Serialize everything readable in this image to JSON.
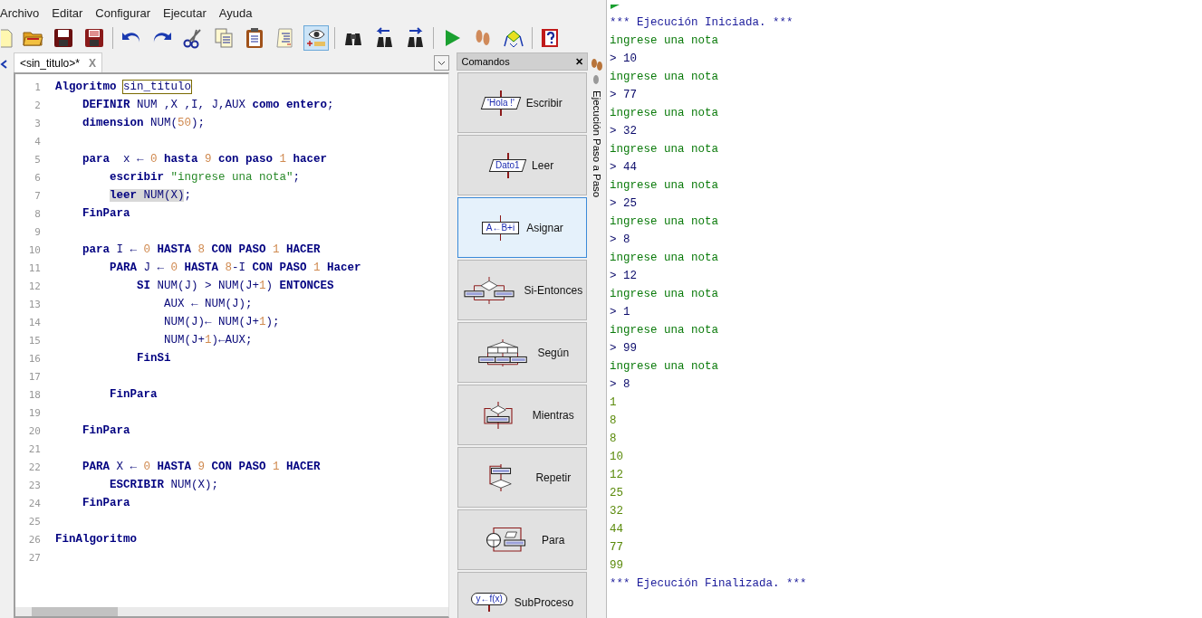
{
  "menu": [
    "Archivo",
    "Editar",
    "Configurar",
    "Ejecutar",
    "Ayuda"
  ],
  "toolbar": [
    {
      "kind": "new",
      "selected": false
    },
    {
      "kind": "open",
      "selected": false
    },
    {
      "kind": "save",
      "selected": false
    },
    {
      "kind": "saveas",
      "selected": false
    },
    {
      "kind": "sep"
    },
    {
      "kind": "undo",
      "selected": false
    },
    {
      "kind": "redo",
      "selected": false
    },
    {
      "kind": "cut",
      "selected": false
    },
    {
      "kind": "copy",
      "selected": false
    },
    {
      "kind": "paste",
      "selected": false
    },
    {
      "kind": "indent",
      "selected": false
    },
    {
      "kind": "watch",
      "selected": true
    },
    {
      "kind": "sep"
    },
    {
      "kind": "find",
      "selected": false
    },
    {
      "kind": "findprev",
      "selected": false
    },
    {
      "kind": "findnext",
      "selected": false
    },
    {
      "kind": "sep"
    },
    {
      "kind": "run",
      "selected": false
    },
    {
      "kind": "steps",
      "selected": false
    },
    {
      "kind": "flow",
      "selected": false
    },
    {
      "kind": "sep"
    },
    {
      "kind": "help",
      "selected": false
    }
  ],
  "editor_tab": {
    "label": "<sin_titulo>*",
    "close": "X"
  },
  "code_lines": [
    {
      "number": "1",
      "tokens": [
        {
          "kind": "keyword",
          "text": "Algoritmo "
        },
        {
          "kind": "boxed",
          "text": "sin_titulo"
        }
      ]
    },
    {
      "number": "2",
      "tokens": [
        {
          "kind": "keyword",
          "text": "    DEFINIR"
        },
        {
          "kind": "plain",
          "text": " NUM ,X ,I, J,AUX "
        },
        {
          "kind": "keyword",
          "text": "como entero"
        },
        {
          "kind": "plain",
          "text": ";"
        }
      ]
    },
    {
      "number": "3",
      "tokens": [
        {
          "kind": "keyword",
          "text": "    dimension"
        },
        {
          "kind": "plain",
          "text": " NUM("
        },
        {
          "kind": "number",
          "text": "50"
        },
        {
          "kind": "plain",
          "text": ");"
        }
      ]
    },
    {
      "number": "4"
    },
    {
      "number": "5",
      "tokens": [
        {
          "kind": "keyword",
          "text": "    para"
        },
        {
          "kind": "plain",
          "text": "  x ← "
        },
        {
          "kind": "number",
          "text": "0"
        },
        {
          "kind": "keyword",
          "text": " hasta "
        },
        {
          "kind": "number",
          "text": "9"
        },
        {
          "kind": "keyword",
          "text": " con paso "
        },
        {
          "kind": "number",
          "text": "1"
        },
        {
          "kind": "keyword",
          "text": " hacer"
        }
      ]
    },
    {
      "number": "6",
      "tokens": [
        {
          "kind": "keyword",
          "text": "        escribir "
        },
        {
          "kind": "string",
          "text": "\"ingrese una nota\""
        },
        {
          "kind": "plain",
          "text": ";"
        }
      ]
    },
    {
      "number": "7",
      "tokens": [
        {
          "kind": "selected-keyword",
          "text": "        leer"
        },
        {
          "kind": "selected-plain",
          "text": " NUM(X)"
        },
        {
          "kind": "plain",
          "text": ";"
        }
      ]
    },
    {
      "number": "8",
      "tokens": [
        {
          "kind": "keyword",
          "text": "    FinPara"
        }
      ]
    },
    {
      "number": "9"
    },
    {
      "number": "10",
      "tokens": [
        {
          "kind": "keyword",
          "text": "    para"
        },
        {
          "kind": "plain",
          "text": " I ← "
        },
        {
          "kind": "number",
          "text": "0"
        },
        {
          "kind": "keyword",
          "text": " HASTA "
        },
        {
          "kind": "number",
          "text": "8"
        },
        {
          "kind": "keyword",
          "text": " CON PASO "
        },
        {
          "kind": "number",
          "text": "1"
        },
        {
          "kind": "keyword",
          "text": " HACER"
        }
      ]
    },
    {
      "number": "11",
      "tokens": [
        {
          "kind": "keyword",
          "text": "        PARA"
        },
        {
          "kind": "plain",
          "text": " J ← "
        },
        {
          "kind": "number",
          "text": "0"
        },
        {
          "kind": "keyword",
          "text": " HASTA "
        },
        {
          "kind": "number",
          "text": "8"
        },
        {
          "kind": "plain",
          "text": "-I "
        },
        {
          "kind": "keyword",
          "text": "CON PASO "
        },
        {
          "kind": "number",
          "text": "1"
        },
        {
          "kind": "keyword",
          "text": " Hacer"
        }
      ]
    },
    {
      "number": "12",
      "tokens": [
        {
          "kind": "keyword",
          "text": "            SI"
        },
        {
          "kind": "plain",
          "text": " NUM(J) > NUM(J+"
        },
        {
          "kind": "number",
          "text": "1"
        },
        {
          "kind": "plain",
          "text": ") "
        },
        {
          "kind": "keyword",
          "text": "ENTONCES"
        }
      ]
    },
    {
      "number": "13",
      "tokens": [
        {
          "kind": "plain",
          "text": "                AUX ← NUM(J);"
        }
      ]
    },
    {
      "number": "14",
      "tokens": [
        {
          "kind": "plain",
          "text": "                NUM(J)← NUM(J+"
        },
        {
          "kind": "number",
          "text": "1"
        },
        {
          "kind": "plain",
          "text": ");"
        }
      ]
    },
    {
      "number": "15",
      "tokens": [
        {
          "kind": "plain",
          "text": "                NUM(J+"
        },
        {
          "kind": "number",
          "text": "1"
        },
        {
          "kind": "plain",
          "text": ")←AUX;"
        }
      ]
    },
    {
      "number": "16",
      "tokens": [
        {
          "kind": "keyword",
          "text": "            FinSi"
        }
      ]
    },
    {
      "number": "17"
    },
    {
      "number": "18",
      "tokens": [
        {
          "kind": "keyword",
          "text": "        FinPara"
        }
      ]
    },
    {
      "number": "19"
    },
    {
      "number": "20",
      "tokens": [
        {
          "kind": "keyword",
          "text": "    FinPara"
        }
      ]
    },
    {
      "number": "21"
    },
    {
      "number": "22",
      "tokens": [
        {
          "kind": "keyword",
          "text": "    PARA"
        },
        {
          "kind": "plain",
          "text": " X ← "
        },
        {
          "kind": "number",
          "text": "0"
        },
        {
          "kind": "keyword",
          "text": " HASTA "
        },
        {
          "kind": "number",
          "text": "9"
        },
        {
          "kind": "keyword",
          "text": " CON PASO "
        },
        {
          "kind": "number",
          "text": "1"
        },
        {
          "kind": "keyword",
          "text": " HACER"
        }
      ]
    },
    {
      "number": "23",
      "tokens": [
        {
          "kind": "keyword",
          "text": "        ESCRIBIR"
        },
        {
          "kind": "plain",
          "text": " NUM(X);"
        }
      ]
    },
    {
      "number": "24",
      "tokens": [
        {
          "kind": "keyword",
          "text": "    FinPara"
        }
      ]
    },
    {
      "number": "25"
    },
    {
      "number": "26",
      "tokens": [
        {
          "kind": "keyword",
          "text": "FinAlgoritmo"
        }
      ]
    },
    {
      "number": "27"
    }
  ],
  "commands_panel": {
    "title": "Comandos",
    "close": "✕",
    "side_tab": "Ejecución Paso a Paso",
    "commands": [
      {
        "kind": "write",
        "label": "Escribir",
        "icon_text": "'Hola !'",
        "selected": false
      },
      {
        "kind": "read",
        "label": "Leer",
        "icon_text": "Dato1",
        "selected": false
      },
      {
        "kind": "assign",
        "label": "Asignar",
        "icon_text": "A←B+i",
        "selected": true
      },
      {
        "kind": "if",
        "label": "Si-Entonces",
        "selected": false
      },
      {
        "kind": "switch",
        "label": "Según",
        "selected": false
      },
      {
        "kind": "while",
        "label": "Mientras",
        "selected": false
      },
      {
        "kind": "repeat",
        "label": "Repetir",
        "selected": false
      },
      {
        "kind": "for",
        "label": "Para",
        "selected": false
      },
      {
        "kind": "subprocess",
        "label": "SubProceso",
        "icon_text": "y←f(x)",
        "selected": false
      }
    ]
  },
  "console_lines": [
    {
      "kind": "info",
      "text": "*** Ejecución Iniciada. ***"
    },
    {
      "kind": "prompt",
      "text": "ingrese una nota"
    },
    {
      "kind": "input",
      "text": "> 10"
    },
    {
      "kind": "prompt",
      "text": "ingrese una nota"
    },
    {
      "kind": "input",
      "text": "> 77"
    },
    {
      "kind": "prompt",
      "text": "ingrese una nota"
    },
    {
      "kind": "input",
      "text": "> 32"
    },
    {
      "kind": "prompt",
      "text": "ingrese una nota"
    },
    {
      "kind": "input",
      "text": "> 44"
    },
    {
      "kind": "prompt",
      "text": "ingrese una nota"
    },
    {
      "kind": "input",
      "text": "> 25"
    },
    {
      "kind": "prompt",
      "text": "ingrese una nota"
    },
    {
      "kind": "input",
      "text": "> 8"
    },
    {
      "kind": "prompt",
      "text": "ingrese una nota"
    },
    {
      "kind": "input",
      "text": "> 12"
    },
    {
      "kind": "prompt",
      "text": "ingrese una nota"
    },
    {
      "kind": "input",
      "text": "> 1"
    },
    {
      "kind": "prompt",
      "text": "ingrese una nota"
    },
    {
      "kind": "input",
      "text": "> 99"
    },
    {
      "kind": "prompt",
      "text": "ingrese una nota"
    },
    {
      "kind": "input",
      "text": "> 8"
    },
    {
      "kind": "output",
      "text": "1"
    },
    {
      "kind": "output",
      "text": "8"
    },
    {
      "kind": "output",
      "text": "8"
    },
    {
      "kind": "output",
      "text": "10"
    },
    {
      "kind": "output",
      "text": "12"
    },
    {
      "kind": "output",
      "text": "25"
    },
    {
      "kind": "output",
      "text": "32"
    },
    {
      "kind": "output",
      "text": "44"
    },
    {
      "kind": "output",
      "text": "77"
    },
    {
      "kind": "output",
      "text": "99"
    },
    {
      "kind": "info",
      "text": "*** Ejecución Finalizada. ***"
    }
  ]
}
